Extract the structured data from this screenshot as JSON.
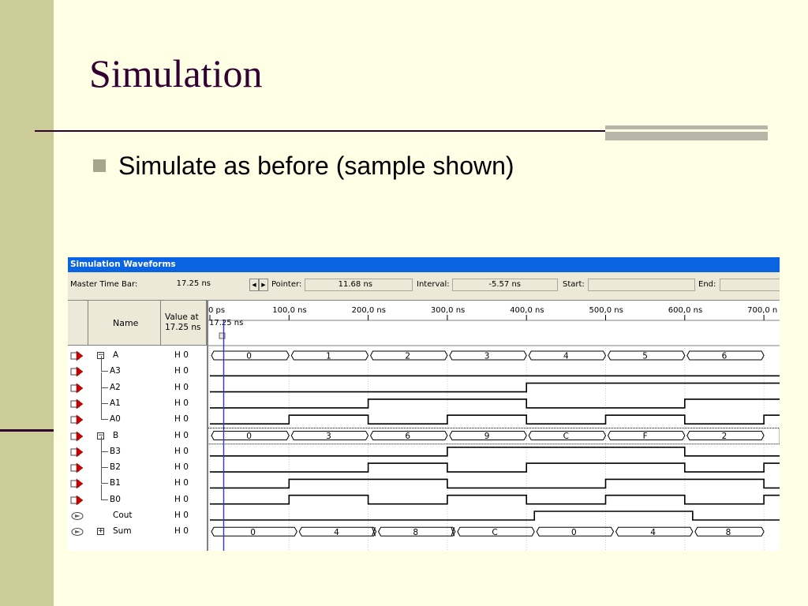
{
  "slide": {
    "title": "Simulation",
    "bullet": "Simulate as before (sample shown)"
  },
  "window": {
    "title": "Simulation Waveforms",
    "toolbar": {
      "master_time_bar_label": "Master Time Bar:",
      "master_time_bar_value": "17.25 ns",
      "pointer_label": "Pointer:",
      "pointer_value": "11.68 ns",
      "interval_label": "Interval:",
      "interval_value": "-5.57 ns",
      "start_label": "Start:",
      "start_value": "",
      "end_label": "End:",
      "end_value": ""
    },
    "columns": {
      "name": "Name",
      "value_line1": "Value at",
      "value_line2": "17.25 ns"
    },
    "time_ruler": {
      "ticks": [
        "0 ps",
        "100,0 ns",
        "200,0 ns",
        "300,0 ns",
        "400,0 ns",
        "500,0 ns",
        "600,0 ns",
        "700,0 n"
      ],
      "cursor_label": "17.25 ns"
    },
    "signals": [
      {
        "name": "A",
        "value": "H 0",
        "kind": "bus",
        "expander": "−",
        "child": false,
        "icon": "input-pin-icon",
        "segments": [
          "0",
          "1",
          "2",
          "3",
          "4",
          "5",
          "6"
        ],
        "trans": [
          1,
          1,
          1,
          1,
          1,
          1,
          1
        ]
      },
      {
        "name": "A3",
        "value": "H 0",
        "kind": "bit",
        "child": true,
        "icon": "input-pin-icon",
        "levels": [
          0,
          0,
          0,
          0,
          0,
          0,
          0,
          0
        ]
      },
      {
        "name": "A2",
        "value": "H 0",
        "kind": "bit",
        "child": true,
        "icon": "input-pin-icon",
        "levels": [
          0,
          0,
          0,
          0,
          1,
          1,
          1,
          1
        ]
      },
      {
        "name": "A1",
        "value": "H 0",
        "kind": "bit",
        "child": true,
        "icon": "input-pin-icon",
        "levels": [
          0,
          0,
          1,
          1,
          0,
          0,
          1,
          1
        ]
      },
      {
        "name": "A0",
        "value": "H 0",
        "kind": "bit",
        "child": true,
        "icon": "input-pin-icon",
        "levels": [
          0,
          1,
          0,
          1,
          0,
          1,
          0,
          1
        ]
      },
      {
        "name": "B",
        "value": "H 0",
        "kind": "bus",
        "expander": "−",
        "child": false,
        "icon": "input-pin-icon",
        "segments": [
          "0",
          "3",
          "6",
          "9",
          "C",
          "F",
          "2"
        ],
        "trans": [
          1,
          1,
          1,
          1,
          1,
          1,
          1
        ]
      },
      {
        "name": "B3",
        "value": "H 0",
        "kind": "bit",
        "child": true,
        "icon": "input-pin-icon",
        "levels": [
          0,
          0,
          0,
          1,
          1,
          1,
          0,
          0
        ]
      },
      {
        "name": "B2",
        "value": "H 0",
        "kind": "bit",
        "child": true,
        "icon": "input-pin-icon",
        "levels": [
          0,
          0,
          1,
          0,
          1,
          1,
          0,
          1
        ]
      },
      {
        "name": "B1",
        "value": "H 0",
        "kind": "bit",
        "child": true,
        "icon": "input-pin-icon",
        "levels": [
          0,
          1,
          1,
          0,
          0,
          1,
          1,
          0
        ]
      },
      {
        "name": "B0",
        "value": "H 0",
        "kind": "bit",
        "child": true,
        "icon": "input-pin-icon",
        "levels": [
          0,
          1,
          0,
          1,
          0,
          1,
          0,
          1
        ]
      },
      {
        "name": "Cout",
        "value": "H 0",
        "kind": "cout",
        "child": false,
        "icon": "output-pin-icon"
      },
      {
        "name": "Sum",
        "value": "H 0",
        "kind": "sumbus",
        "expander": "+",
        "child": false,
        "icon": "output-pin-icon",
        "segments": [
          "0",
          "4",
          "8",
          "C",
          "0",
          "4",
          "8"
        ]
      }
    ]
  },
  "colors": {
    "title": "#330033",
    "left_bar": "#cccc99",
    "background": "#ffffe6",
    "window_title_bar": "#0a63e0",
    "cursor_line": "#3333cc"
  }
}
